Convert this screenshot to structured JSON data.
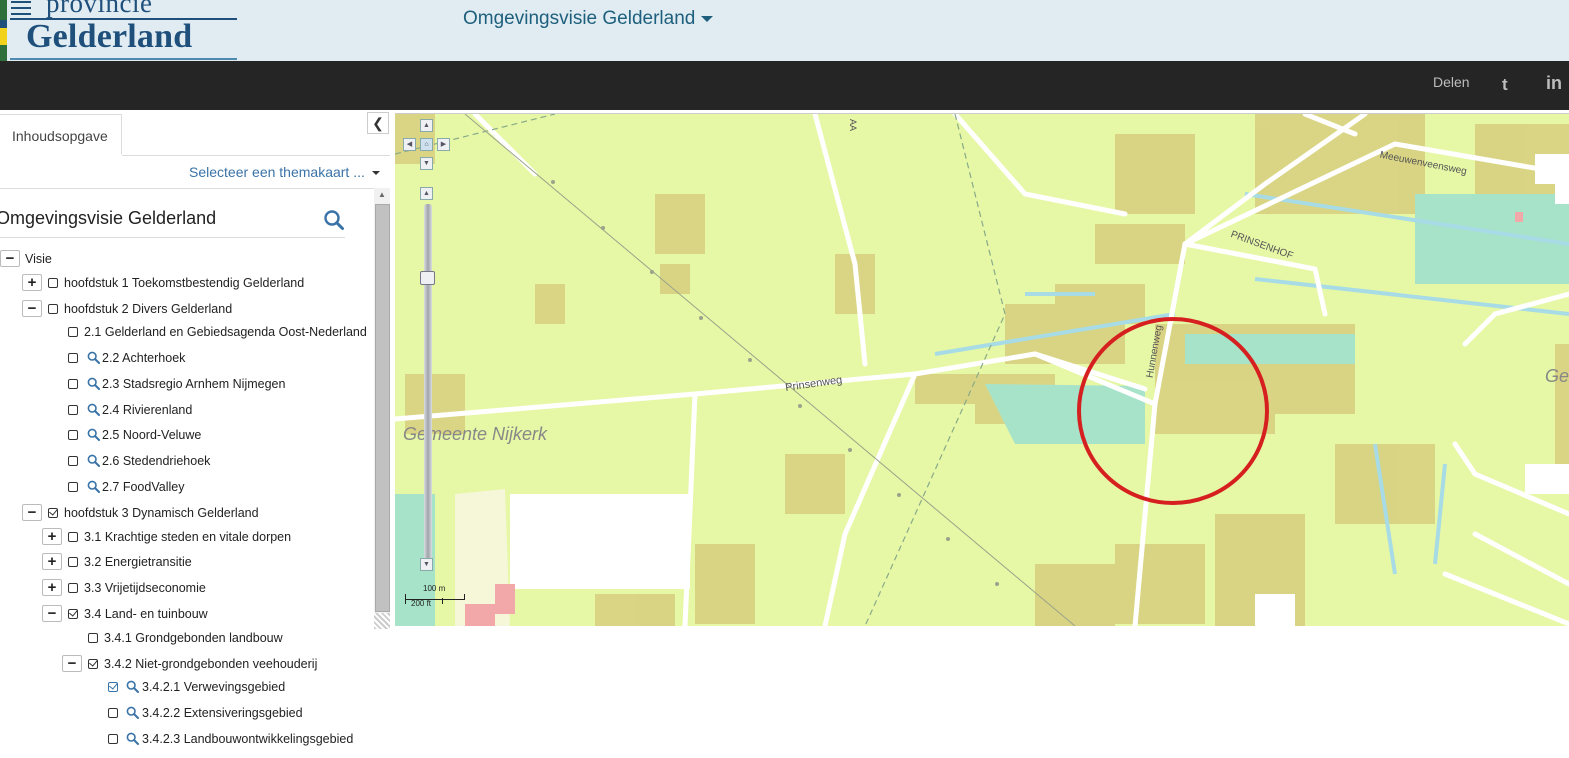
{
  "header": {
    "logo_line1": "provincie",
    "logo_line2": "Gelderland",
    "title": "Omgevingsvisie Gelderland"
  },
  "social": {
    "share_label": "Delen",
    "twitter_glyph": "t",
    "linkedin_glyph": "in"
  },
  "panel": {
    "tab_label": "Inhoudsopgave",
    "collapse_glyph": "❮",
    "themakaart_label": "Selecteer een themakaart ...",
    "tree_title": "Omgevingsvisie Gelderland"
  },
  "tree": [
    {
      "label": "Visie",
      "toggle": "−",
      "checkbox": "none",
      "search": false
    },
    {
      "label": "hoofdstuk 1 Toekomstbestendig Gelderland",
      "toggle": "+",
      "checkbox": "unchecked",
      "search": false
    },
    {
      "label": "hoofdstuk 2 Divers Gelderland",
      "toggle": "−",
      "checkbox": "unchecked",
      "search": false
    },
    {
      "label": "2.1 Gelderland en Gebiedsagenda Oost-Nederland",
      "toggle": "",
      "checkbox": "unchecked",
      "search": false
    },
    {
      "label": "2.2 Achterhoek",
      "toggle": "",
      "checkbox": "unchecked",
      "search": true
    },
    {
      "label": "2.3 Stadsregio Arnhem Nijmegen",
      "toggle": "",
      "checkbox": "unchecked",
      "search": true
    },
    {
      "label": "2.4 Rivierenland",
      "toggle": "",
      "checkbox": "unchecked",
      "search": true
    },
    {
      "label": "2.5 Noord-Veluwe",
      "toggle": "",
      "checkbox": "unchecked",
      "search": true
    },
    {
      "label": "2.6 Stedendriehoek",
      "toggle": "",
      "checkbox": "unchecked",
      "search": true
    },
    {
      "label": "2.7 FoodValley",
      "toggle": "",
      "checkbox": "unchecked",
      "search": true
    },
    {
      "label": "hoofdstuk 3 Dynamisch Gelderland",
      "toggle": "−",
      "checkbox": "checked",
      "search": false
    },
    {
      "label": "3.1 Krachtige steden en vitale dorpen",
      "toggle": "+",
      "checkbox": "unchecked",
      "search": false
    },
    {
      "label": "3.2 Energietransitie",
      "toggle": "+",
      "checkbox": "unchecked",
      "search": false
    },
    {
      "label": "3.3 Vrijetijdseconomie",
      "toggle": "+",
      "checkbox": "unchecked",
      "search": false
    },
    {
      "label": "3.4 Land- en tuinbouw",
      "toggle": "−",
      "checkbox": "checked",
      "search": false
    },
    {
      "label": "3.4.1 Grondgebonden landbouw",
      "toggle": "",
      "checkbox": "unchecked",
      "search": false
    },
    {
      "label": "3.4.2 Niet-grondgebonden veehouderij",
      "toggle": "−",
      "checkbox": "checked",
      "search": false
    },
    {
      "label": "3.4.2.1 Verwevingsgebied",
      "toggle": "",
      "checkbox": "checked-blue",
      "search": true
    },
    {
      "label": "3.4.2.2 Extensiveringsgebied",
      "toggle": "",
      "checkbox": "unchecked",
      "search": true
    },
    {
      "label": "3.4.2.3 Landbouwontwikkelingsgebied",
      "toggle": "",
      "checkbox": "unchecked",
      "search": true
    }
  ],
  "map": {
    "labels": {
      "prinsenweg": "Prinsenweg",
      "gemeente": "Gemeente  Nijkerk",
      "hunnenweg": "Hunnenweg",
      "prinsenhof": "PRINSENHOF",
      "meeuwenveensweg": "Meeuwenveensweg",
      "ge": "Ge",
      "aa": "AA"
    },
    "scale": {
      "metric": "100 m",
      "imperial": "200 ft"
    },
    "colors": {
      "base": "#e6f7a6",
      "built": "#d7cf7e",
      "water": "#a7e3c8",
      "highlight": "#d62020"
    }
  }
}
